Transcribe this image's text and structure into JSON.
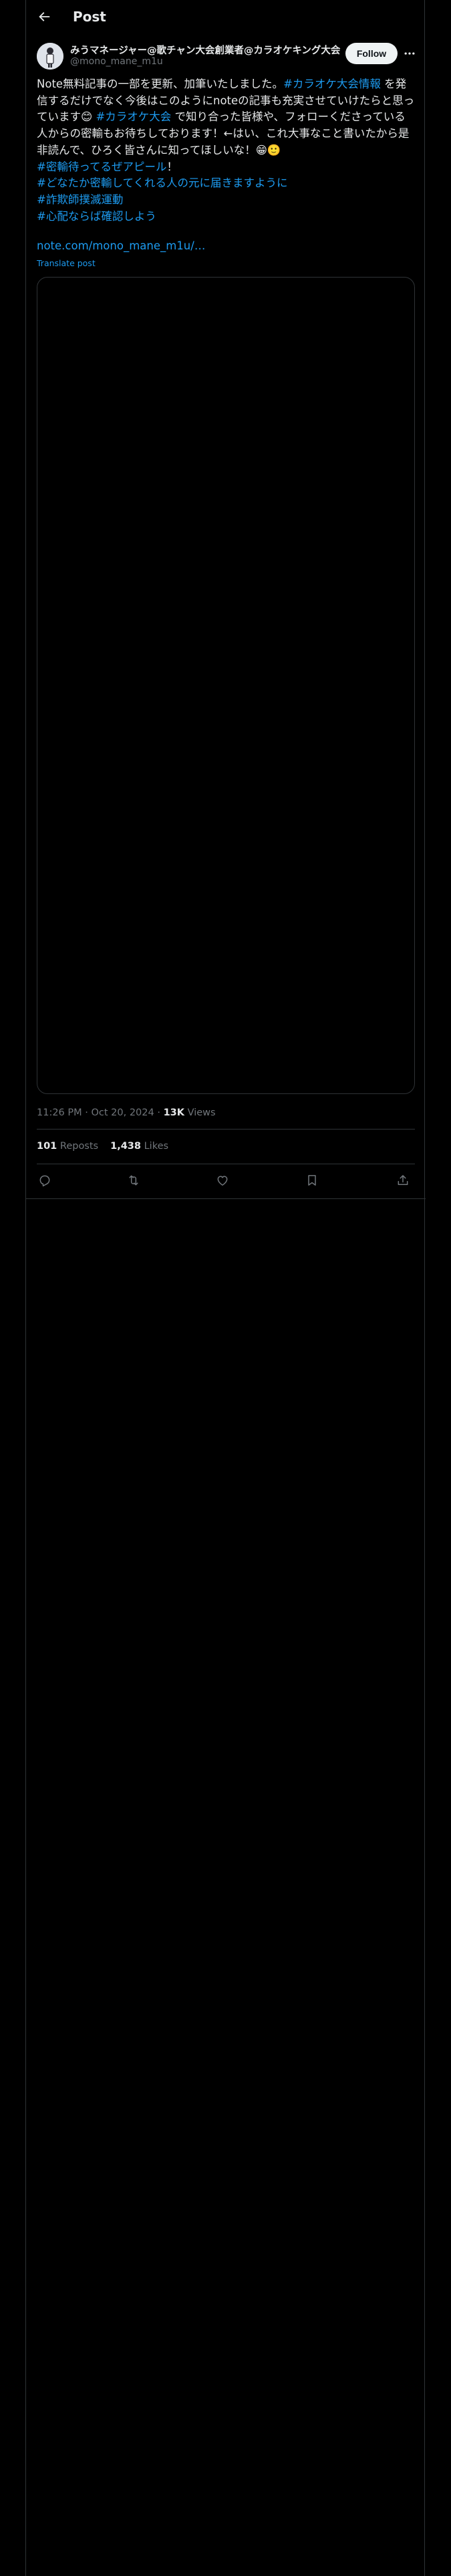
{
  "header": {
    "title": "Post"
  },
  "author": {
    "name": "みうマネージャー@歌チャン大会創業者@カラオケキング大会",
    "handle": "@mono_mane_m1u",
    "follow_label": "Follow"
  },
  "post": {
    "segments": [
      {
        "text": "Note無料記事の一部を更新、加筆いたしました。",
        "tag": false
      },
      {
        "text": "#カラオケ大会情報",
        "tag": true
      },
      {
        "text": " を発信するだけでなく今後はこのようにnoteの記事も充実させていけたらと思っています😊 ",
        "tag": false
      },
      {
        "text": "#カラオケ大会",
        "tag": true
      },
      {
        "text": " で知り合った皆様や、フォローくださっている人からの密輸もお待ちしております！←はい、これ大事なこと書いたから是非読んで、ひろく皆さんに知ってほしいな！😁🙂",
        "tag": false
      }
    ],
    "hashtag_lines": [
      {
        "tag": "#密輸待ってるぜアピール",
        "suffix": "！"
      },
      {
        "tag": "#どなたか密輸してくれる人の元に届きますように",
        "suffix": ""
      },
      {
        "tag": "#詐欺師撲滅運動",
        "suffix": ""
      },
      {
        "tag": "#心配ならば確認しよう",
        "suffix": ""
      }
    ],
    "link": "note.com/mono_mane_m1u/…",
    "translate_label": "Translate post",
    "time": "11:26 PM",
    "date": "Oct 20, 2024",
    "views_count": "13K",
    "views_label": "Views",
    "reposts_count": "101",
    "reposts_label": "Reposts",
    "likes_count": "1,438",
    "likes_label": "Likes"
  },
  "icons": {
    "back": "arrow-left-icon",
    "more": "more-dots-icon",
    "reply": "reply-icon",
    "repost": "repost-icon",
    "like": "heart-icon",
    "bookmark": "bookmark-icon",
    "share": "share-icon"
  },
  "colors": {
    "accent": "#1d9bf0",
    "text": "#e7e9ea",
    "muted": "#71767b",
    "border": "#2f3336"
  }
}
